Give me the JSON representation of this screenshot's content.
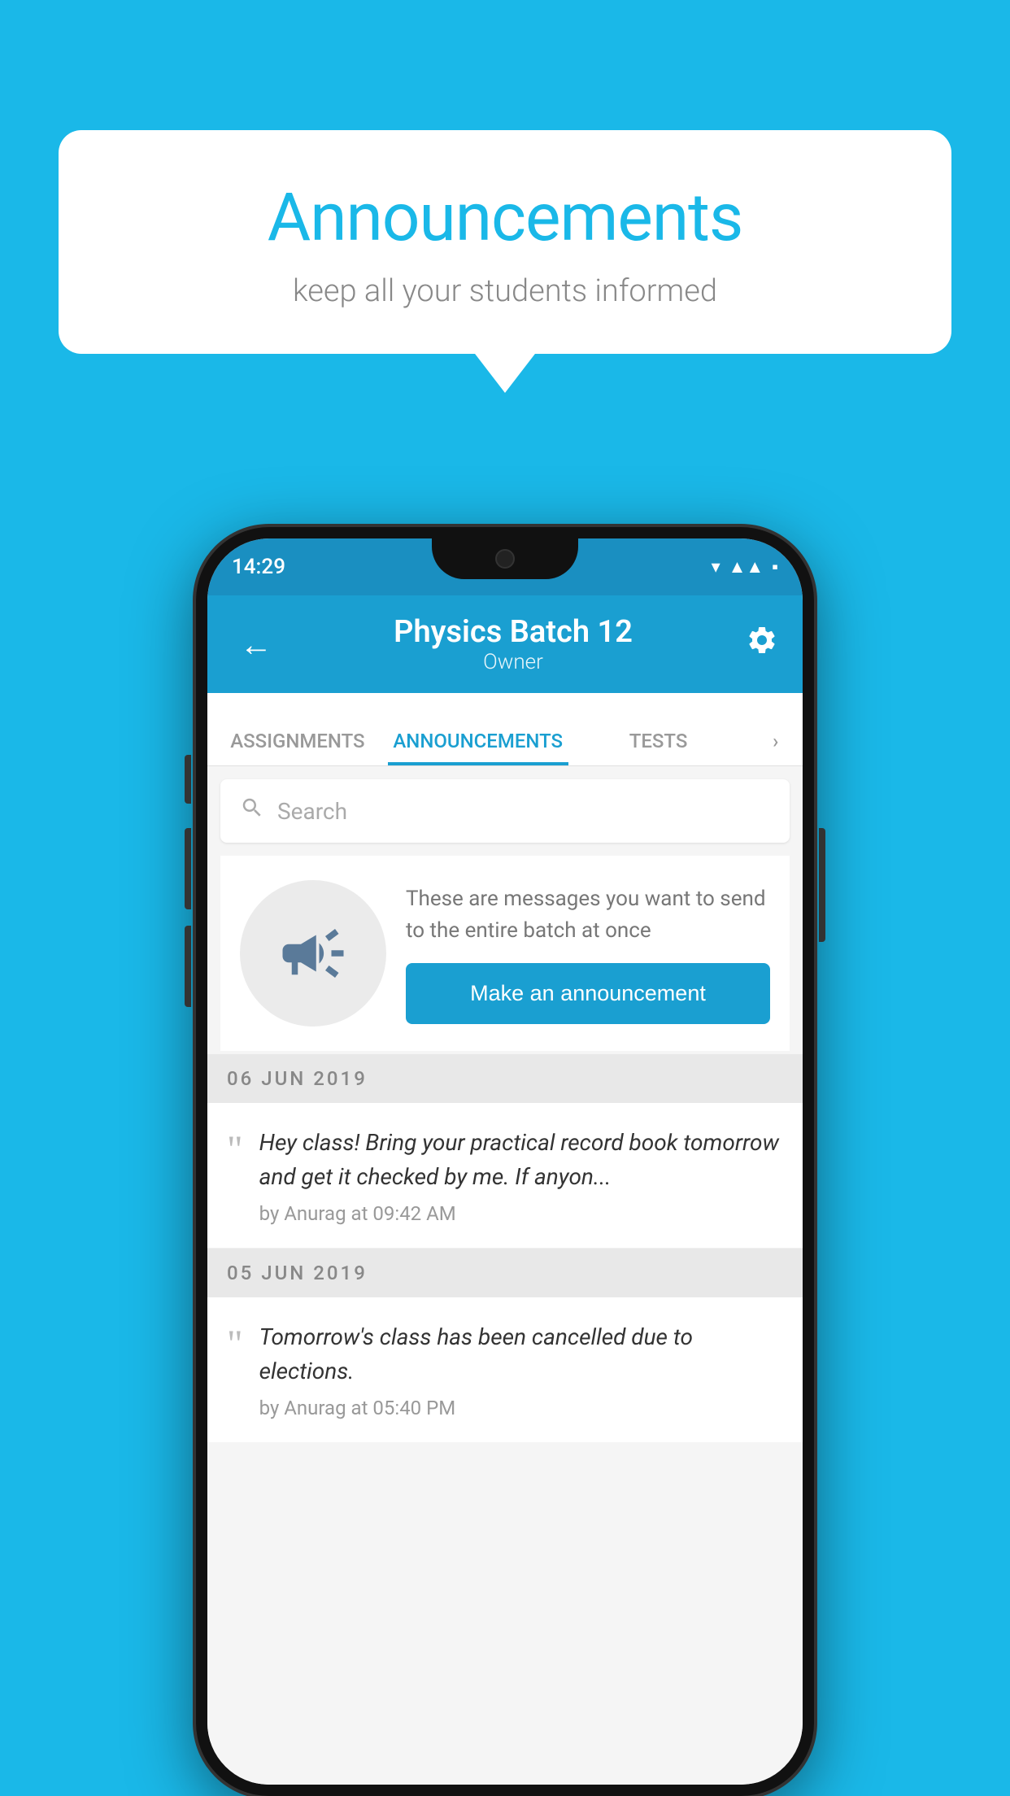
{
  "background_color": "#1ab8e8",
  "speech_bubble": {
    "title": "Announcements",
    "subtitle": "keep all your students informed"
  },
  "status_bar": {
    "time": "14:29",
    "icons": [
      "▾◂▪"
    ]
  },
  "app_bar": {
    "title": "Physics Batch 12",
    "subtitle": "Owner",
    "back_label": "←",
    "settings_label": "⚙"
  },
  "tabs": [
    {
      "label": "ASSIGNMENTS",
      "active": false
    },
    {
      "label": "ANNOUNCEMENTS",
      "active": true
    },
    {
      "label": "TESTS",
      "active": false
    },
    {
      "label": "...",
      "active": false
    }
  ],
  "search": {
    "placeholder": "Search"
  },
  "promo": {
    "description": "These are messages you want to send to the entire batch at once",
    "button_label": "Make an announcement"
  },
  "date_groups": [
    {
      "date": "06  JUN  2019",
      "announcements": [
        {
          "text": "Hey class! Bring your practical record book tomorrow and get it checked by me. If anyon...",
          "meta": "by Anurag at 09:42 AM"
        }
      ]
    },
    {
      "date": "05  JUN  2019",
      "announcements": [
        {
          "text": "Tomorrow's class has been cancelled due to elections.",
          "meta": "by Anurag at 05:40 PM"
        }
      ]
    }
  ]
}
